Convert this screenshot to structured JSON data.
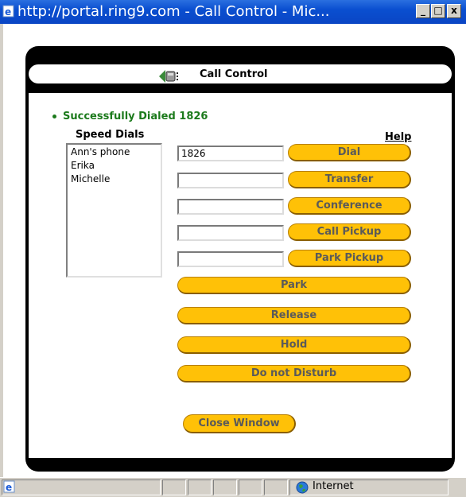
{
  "window": {
    "title": "http://portal.ring9.com - Call Control - Mic...",
    "controls": [
      "_",
      "□",
      "x"
    ]
  },
  "panel": {
    "title": "Call Control"
  },
  "status": {
    "message": "Successfully Dialed 1826",
    "color": "#1c7a1c"
  },
  "speed_dials": {
    "heading": "Speed Dials",
    "items": [
      "Ann's phone",
      "Erika",
      "Michelle"
    ]
  },
  "help_label": "Help",
  "fields": {
    "dial_value": "1826",
    "transfer_value": "",
    "conference_value": "",
    "call_pickup_value": "",
    "park_pickup_value": ""
  },
  "buttons": {
    "dial": "Dial",
    "transfer": "Transfer",
    "conference": "Conference",
    "call_pickup": "Call Pickup",
    "park_pickup": "Park Pickup",
    "park": "Park",
    "release": "Release",
    "hold": "Hold",
    "do_not_disturb": "Do not Disturb",
    "close_window": "Close Window"
  },
  "statusbar": {
    "zone": "Internet"
  },
  "colors": {
    "titlebar": "#0a4fd0",
    "button": "#ffc107",
    "panel": "#000000"
  }
}
